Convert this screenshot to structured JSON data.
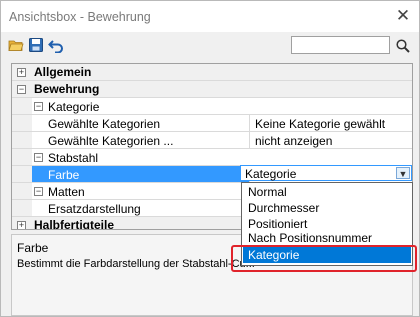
{
  "window": {
    "title": "Ansichtsbox - Bewehrung",
    "close_glyph": "✕"
  },
  "toolbar": {
    "icons": [
      "open-folder-icon",
      "save-icon",
      "undo-icon"
    ],
    "search_value": "",
    "search_icon": "search-icon"
  },
  "grid": {
    "categories": {
      "allgemein": {
        "label": "Allgemein",
        "expander": "+"
      },
      "bewehrung": {
        "label": "Bewehrung",
        "expander": "−"
      },
      "halbfertigteile": {
        "label": "Halbfertigteile",
        "expander": "+"
      }
    },
    "kategorie": {
      "label": "Kategorie",
      "expander": "−",
      "rows": [
        {
          "name": "Gewählte Kategorien",
          "value": "Keine Kategorie gewählt"
        },
        {
          "name": "Gewählte Kategorien ...",
          "value": "nicht anzeigen"
        }
      ]
    },
    "stabstahl": {
      "label": "Stabstahl",
      "expander": "−",
      "farbe": {
        "name": "Farbe",
        "value": "Kategorie"
      }
    },
    "matten": {
      "label": "Matten",
      "expander": "−",
      "ersatz": {
        "name": "Ersatzdarstellung",
        "value": ""
      }
    }
  },
  "dropdown": {
    "options": [
      "Normal",
      "Durchmesser",
      "Positioniert",
      "Nach Positionsnummer",
      "Kategorie"
    ],
    "selected": "Kategorie"
  },
  "description": {
    "title": "Farbe",
    "text": "Bestimmt die Farbdarstellung der Stabstahl-Cu..."
  },
  "colors": {
    "selection": "#3399ff",
    "dropdown_selected": "#0078d7",
    "highlight_box": "#e0232b"
  }
}
